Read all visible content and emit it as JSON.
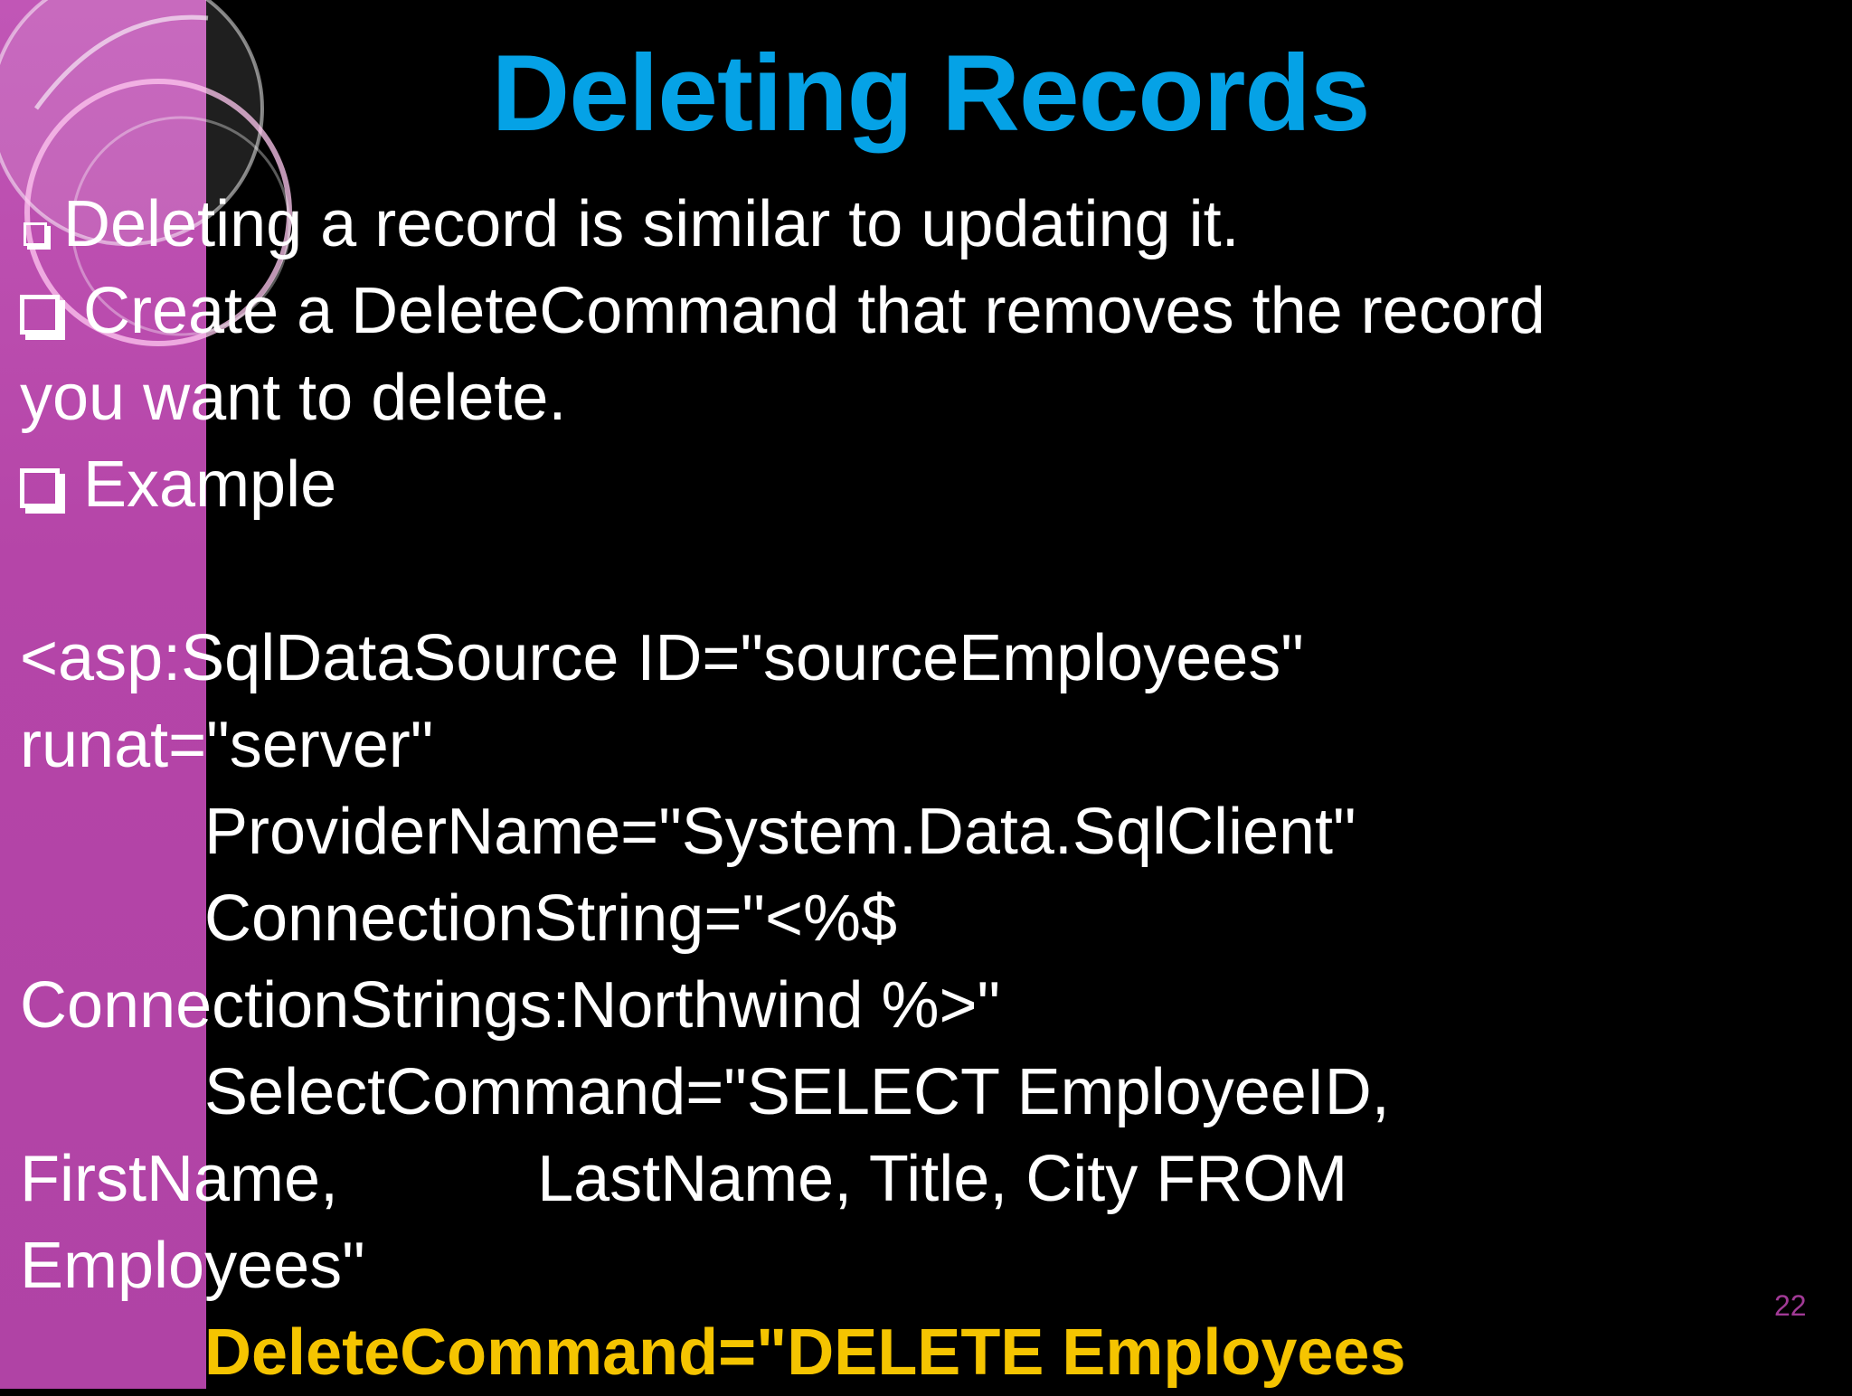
{
  "slide": {
    "title": "Deleting Records",
    "bullets": [
      "Deleting a record is similar to updating it.",
      "Create a DeleteCommand that removes the record",
      "you want to delete.",
      "Example"
    ],
    "code_lines": [
      "<asp:SqlDataSource ID=\"sourceEmployees\"",
      "runat=\"server\"",
      "ProviderName=\"System.Data.SqlClient\"",
      "ConnectionString=\"<%$",
      "ConnectionStrings:Northwind %>\"",
      "SelectCommand=\"SELECT EmployeeID,",
      "FirstName,           LastName, Title, City FROM",
      "Employees\"",
      "DeleteCommand=\"DELETE Employees"
    ],
    "page_number": "22",
    "colors": {
      "background": "#000000",
      "sidebar": "#b545a8",
      "title": "#05a2e6",
      "text": "#ffffff",
      "highlight": "#f5c400"
    }
  }
}
